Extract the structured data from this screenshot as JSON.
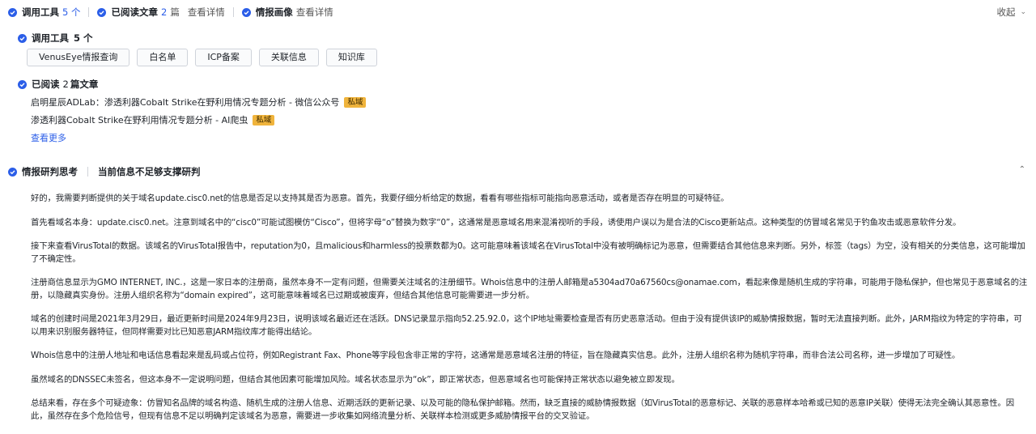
{
  "top_bar": {
    "tools_label": "调用工具",
    "tools_count": "5 个",
    "read_label": "已阅读文章",
    "read_count": "2",
    "read_unit": "篇",
    "read_detail": "查看详情",
    "profile_label": "情报画像",
    "profile_detail": "查看详情",
    "collapse_label": "收起"
  },
  "tools_section": {
    "title": "调用工具",
    "count": "5 个",
    "tools": [
      "VenusEye情报查询",
      "白名单",
      "ICP备案",
      "关联信息",
      "知识库"
    ]
  },
  "read_section": {
    "title_prefix": "已阅读",
    "count": "2",
    "title_suffix": "篇文章",
    "articles": [
      {
        "title": "启明星辰ADLab：渗透利器Cobalt Strike在野利用情况专题分析 - 微信公众号",
        "tag": "私域"
      },
      {
        "title": "渗透利器Cobalt Strike在野利用情况专题分析 - AI爬虫",
        "tag": "私域"
      }
    ],
    "more": "查看更多"
  },
  "thinking_section": {
    "title": "情报研判思考",
    "status": "当前信息不足够支撑研判",
    "paragraphs": [
      "好的，我需要判断提供的关于域名update.cisc0.net的信息是否足以支持其是否为恶意。首先，我要仔细分析给定的数据，看看有哪些指标可能指向恶意活动，或者是否存在明显的可疑特征。",
      "首先看域名本身：update.cisc0.net。注意到域名中的“cisc0”可能试图模仿“Cisco”，但将字母“o”替换为数字“0”，这通常是恶意域名用来混淆视听的手段，诱使用户误以为是合法的Cisco更新站点。这种类型的仿冒域名常见于钓鱼攻击或恶意软件分发。",
      "接下来查看VirusTotal的数据。该域名的VirusTotal报告中，reputation为0，且malicious和harmless的投票数都为0。这可能意味着该域名在VirusTotal中没有被明确标记为恶意，但需要结合其他信息来判断。另外，标签（tags）为空，没有相关的分类信息，这可能增加了不确定性。",
      "注册商信息显示为GMO INTERNET, INC.，这是一家日本的注册商，虽然本身不一定有问题，但需要关注域名的注册细节。Whois信息中的注册人邮箱是a5304ad70a67560cs@onamae.com，看起来像是随机生成的字符串，可能用于隐私保护，但也常见于恶意域名的注册，以隐藏真实身份。注册人组织名称为“domain expired”，这可能意味着域名已过期或被废弃，但结合其他信息可能需要进一步分析。",
      "域名的创建时间是2021年3月29日，最近更新时间是2024年9月23日，说明该域名最近还在活跃。DNS记录显示指向52.25.92.0，这个IP地址需要检查是否有历史恶意活动。但由于没有提供该IP的威胁情报数据，暂时无法直接判断。此外，JARM指纹为特定的字符串，可以用来识别服务器特征，但同样需要对比已知恶意JARM指纹库才能得出结论。",
      "Whois信息中的注册人地址和电话信息看起来是乱码或占位符，例如Registrant Fax、Phone等字段包含非正常的字符，这通常是恶意域名注册的特征，旨在隐藏真实信息。此外，注册人组织名称为随机字符串，而非合法公司名称，进一步增加了可疑性。",
      "虽然域名的DNSSEC未签名，但这本身不一定说明问题，但结合其他因素可能增加风险。域名状态显示为“ok”，即正常状态，但恶意域名也可能保持正常状态以避免被立即发现。",
      "总结来看，存在多个可疑迹象：仿冒知名品牌的域名构造、随机生成的注册人信息、近期活跃的更新记录、以及可能的隐私保护邮箱。然而，缺乏直接的威胁情报数据（如VirusTotal的恶意标记、关联的恶意样本哈希或已知的恶意IP关联）使得无法完全确认其恶意性。因此，虽然存在多个危险信号，但现有信息不足以明确判定该域名为恶意，需要进一步收集如网络流量分析、关联样本检测或更多威胁情报平台的交叉验证。"
    ]
  }
}
